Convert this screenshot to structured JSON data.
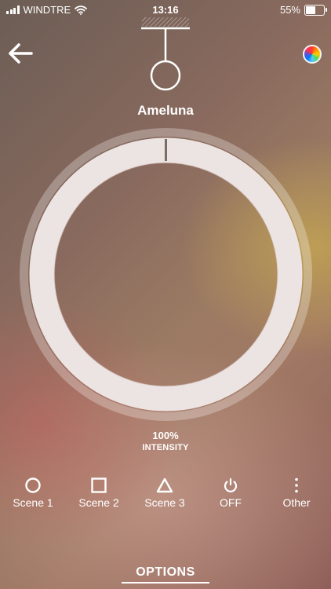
{
  "status_bar": {
    "carrier": "WINDTRE",
    "time": "13:16",
    "battery_percent": "55%",
    "battery_level": 0.55
  },
  "header": {
    "device_name": "Ameluna",
    "back_icon": "arrow-left-icon",
    "color_icon": "color-wheel-icon",
    "lamp_icon": "pendant-lamp-icon"
  },
  "dial": {
    "intensity_value": "100%",
    "intensity_label": "INTENSITY",
    "level": 1.0
  },
  "scenes": [
    {
      "label": "Scene 1",
      "icon": "circle-icon"
    },
    {
      "label": "Scene 2",
      "icon": "square-icon"
    },
    {
      "label": "Scene 3",
      "icon": "triangle-icon"
    },
    {
      "label": "OFF",
      "icon": "power-icon"
    },
    {
      "label": "Other",
      "icon": "more-vertical-icon"
    }
  ],
  "footer": {
    "options_label": "OPTIONS"
  },
  "colors": {
    "foreground": "#ffffff",
    "ring": "#ece4e2"
  }
}
